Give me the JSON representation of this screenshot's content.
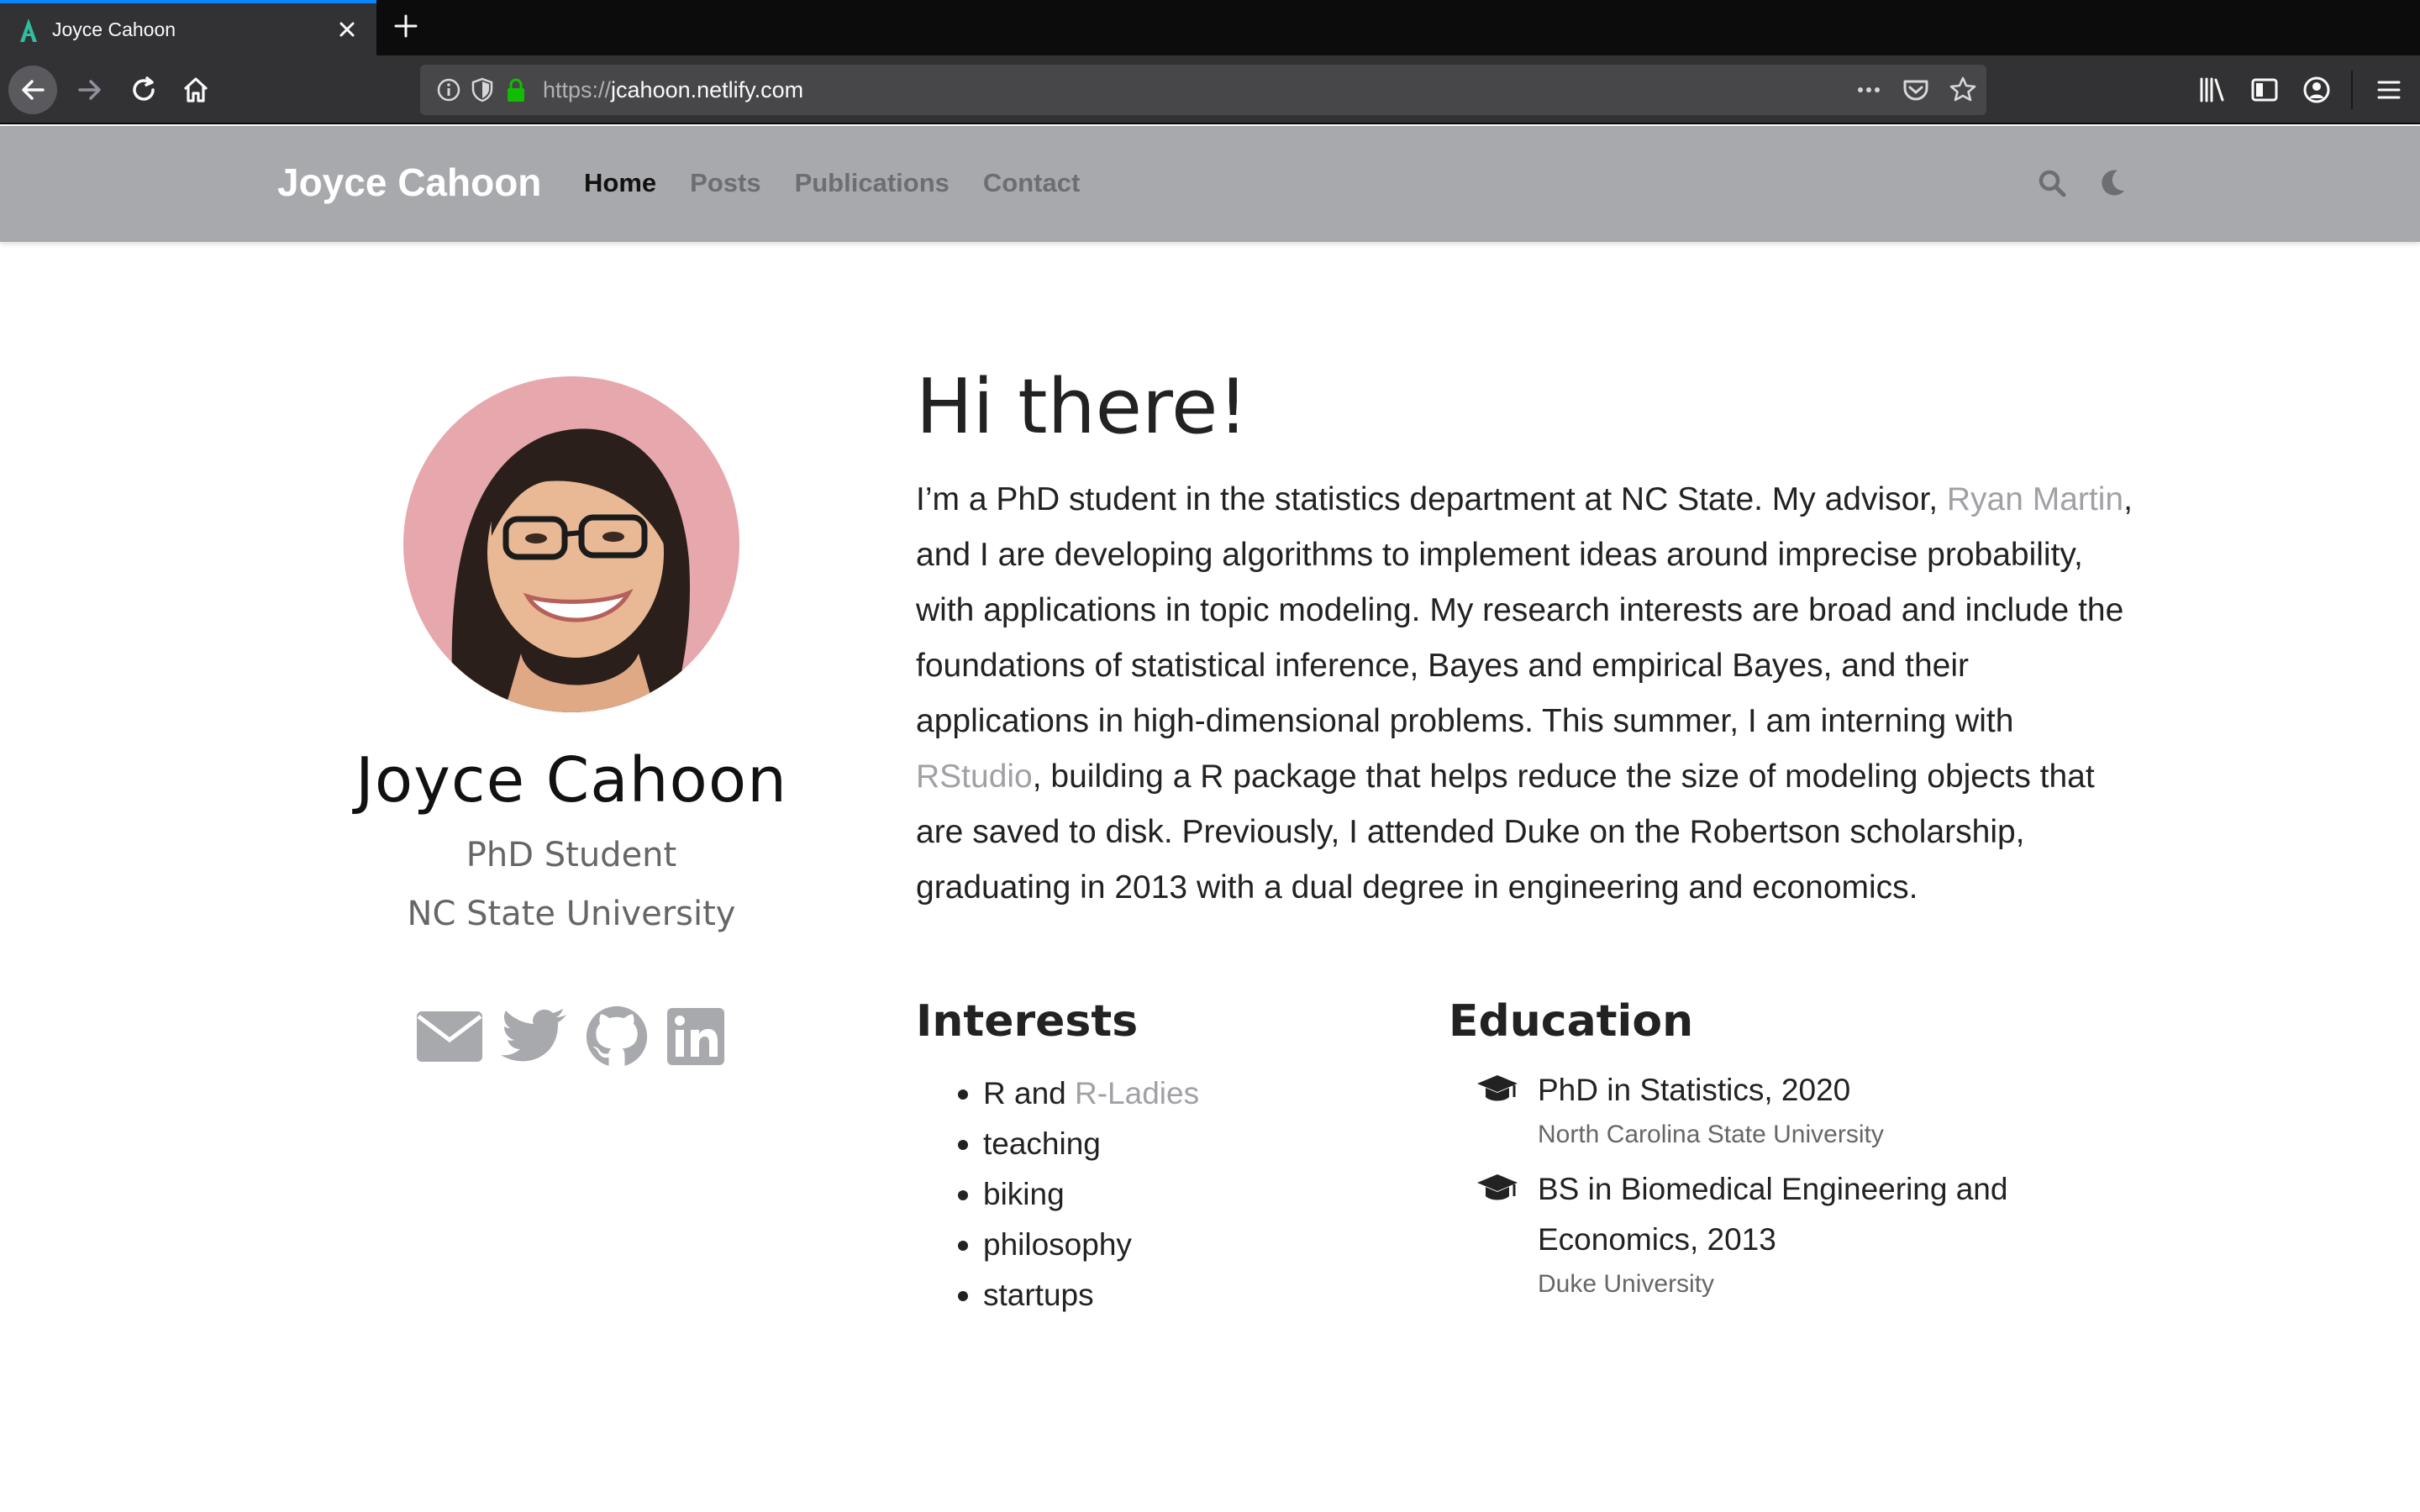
{
  "browser": {
    "tab_title": "Joyce Cahoon",
    "url_prefix": "https://",
    "url_host": "jcahoon.netlify.com"
  },
  "site": {
    "brand": "Joyce Cahoon",
    "menu": [
      "Home",
      "Posts",
      "Publications",
      "Contact"
    ],
    "active_menu": "Home"
  },
  "profile": {
    "name": "Joyce Cahoon",
    "role": "PhD Student",
    "organization": "NC State University",
    "social_icons": [
      "envelope-icon",
      "twitter-icon",
      "github-icon",
      "linkedin-icon"
    ]
  },
  "about": {
    "greeting": "Hi there!",
    "bio_1": "I’m a PhD student in the statistics department at NC State. My advisor, ",
    "advisor_link": "Ryan Martin",
    "bio_2": ", and I are developing algorithms to implement ideas around imprecise probability, with applications in topic modeling. My research interests are broad and include the foundations of statistical inference, Bayes and empirical Bayes, and their applications in high-dimensional problems. This summer, I am interning with ",
    "rstudio_link": "RStudio",
    "bio_3": ", building a R package that helps reduce the size of modeling objects that are saved to disk. Previously, I attended Duke on the Robertson scholarship, graduating in 2013 with a dual degree in engineering and economics."
  },
  "interests": {
    "title": "Interests",
    "first_prefix": "R and ",
    "first_link": "R-Ladies",
    "items": [
      "teaching",
      "biking",
      "philosophy",
      "startups"
    ]
  },
  "education": {
    "title": "Education",
    "items": [
      {
        "degree": "PhD in Statistics, 2020",
        "school": "North Carolina State University"
      },
      {
        "degree": "BS in Biomedical Engineering and Economics, 2013",
        "school": "Duke University"
      }
    ]
  },
  "colors": {
    "header_bg": "#a8a9ad",
    "link": "#a0a1a5",
    "accent_tab": "#0a84ff",
    "ssl_lock": "#12bc00"
  }
}
